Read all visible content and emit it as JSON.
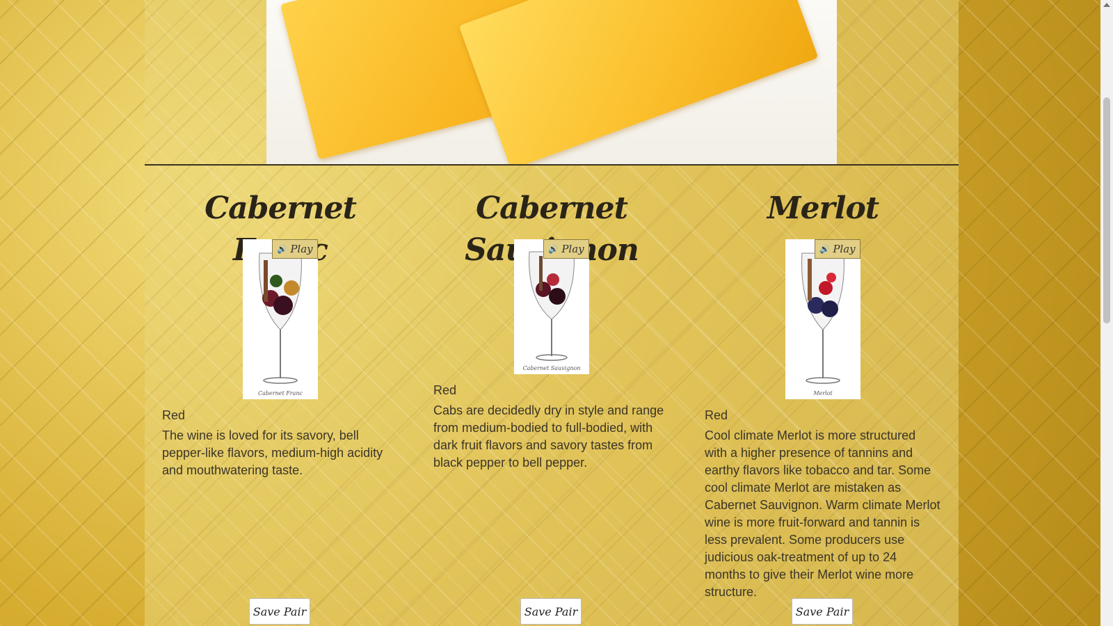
{
  "hero": {
    "image_name": "cheese-photo"
  },
  "pairs": [
    {
      "title": "Cabernet Franc",
      "image_caption": "Cabernet Franc",
      "play_label": "Play",
      "type": "Red",
      "description": "The wine is loved for its savory, bell pepper-like flavors, medium-high acidity and mouthwatering taste.",
      "save_label": "Save Pair"
    },
    {
      "title": "Cabernet Sauvignon",
      "image_caption": "Cabernet Sauvignon",
      "play_label": "Play",
      "type": "Red",
      "description": "Cabs are decidedly dry in style and range from medium-bodied to full-bodied, with dark fruit flavors and savory tastes from black pepper to bell pepper.",
      "save_label": "Save Pair"
    },
    {
      "title": "Merlot",
      "image_caption": "Merlot",
      "play_label": "Play",
      "type": "Red",
      "description": "Cool climate Merlot is more structured with a higher presence of tannins and earthy flavors like tobacco and tar. Some cool climate Merlot are mistaken as Cabernet Sauvignon. Warm climate Merlot wine is more fruit-forward and tannin is less prevalent. Some producers use judicious oak-treatment of up to 24 months to give their Merlot wine more structure.",
      "save_label": "Save Pair"
    }
  ],
  "icons": {
    "play": "speaker-icon"
  },
  "colors": {
    "play_button_bg": "#e2cf85",
    "text": "#3b3528",
    "title": "#2a2418"
  }
}
